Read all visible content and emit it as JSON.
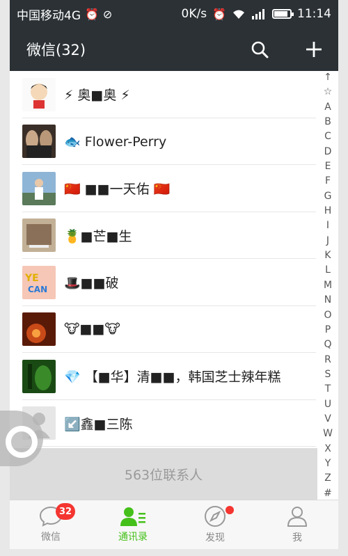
{
  "statusbar": {
    "carrier": "中国移动4G",
    "speed": "0K/s",
    "network": "4G",
    "time": "11:14"
  },
  "header": {
    "title": "微信(32)"
  },
  "contacts": [
    {
      "name": "⚡ 奥■奥 ⚡",
      "avatar_color": "#f3f3f3"
    },
    {
      "name": "🐟 Flower-Perry",
      "avatar_color": "#6a5a4a"
    },
    {
      "name": "🇨🇳  ■■一天佑 🇨🇳",
      "avatar_color": "#7ea6c9"
    },
    {
      "name": "🍍■芒■生",
      "avatar_color": "#b8a48a"
    },
    {
      "name": "🎩■■破",
      "avatar_color": "#f2b8a8"
    },
    {
      "name": "🐮■■🐮",
      "avatar_color": "#8a2a10"
    },
    {
      "name": "💎 【■华】清■■，韩国芝士辣年糕",
      "avatar_color": "#1f5a1f"
    },
    {
      "name": "↙️鑫■三陈",
      "avatar_color": "#e8e8e8"
    }
  ],
  "index": [
    "↑",
    "☆",
    "A",
    "B",
    "C",
    "D",
    "E",
    "F",
    "G",
    "H",
    "I",
    "J",
    "K",
    "L",
    "M",
    "N",
    "O",
    "P",
    "Q",
    "R",
    "S",
    "T",
    "U",
    "V",
    "W",
    "X",
    "Y",
    "Z",
    "#"
  ],
  "contacts_count": "563位联系人",
  "tabs": [
    {
      "label": "微信",
      "badge": "32"
    },
    {
      "label": "通讯录"
    },
    {
      "label": "发现"
    },
    {
      "label": "我"
    }
  ],
  "colors": {
    "header_bg": "#2b3135",
    "accent_green": "#45c01a",
    "badge_red": "#f43530"
  }
}
